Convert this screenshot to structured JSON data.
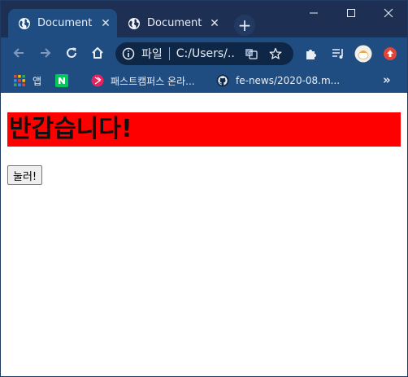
{
  "tabs": [
    {
      "title": "Document",
      "close": "✕",
      "active": true
    },
    {
      "title": "Document",
      "close": "✕",
      "active": false
    }
  ],
  "new_tab_label": "+",
  "toolbar": {
    "omnibox_scheme": "파일",
    "omnibox_url": "C:/Users/..."
  },
  "bookmarks": [
    {
      "label": "앱",
      "icon": "apps-grid-icon"
    },
    {
      "label": "",
      "icon": "naver-icon"
    },
    {
      "label": "패스트캠퍼스 온라...",
      "icon": "fastcampus-icon"
    },
    {
      "label": "fe-news/2020-08.m...",
      "icon": "github-icon"
    }
  ],
  "bookmarks_overflow": "»",
  "page": {
    "heading": "반갑습니다!",
    "button_label": "눌러!"
  },
  "colors": {
    "titlebar": "#1d2f52",
    "toolbar": "#1f4d82",
    "heading_background": "#ff0000"
  }
}
